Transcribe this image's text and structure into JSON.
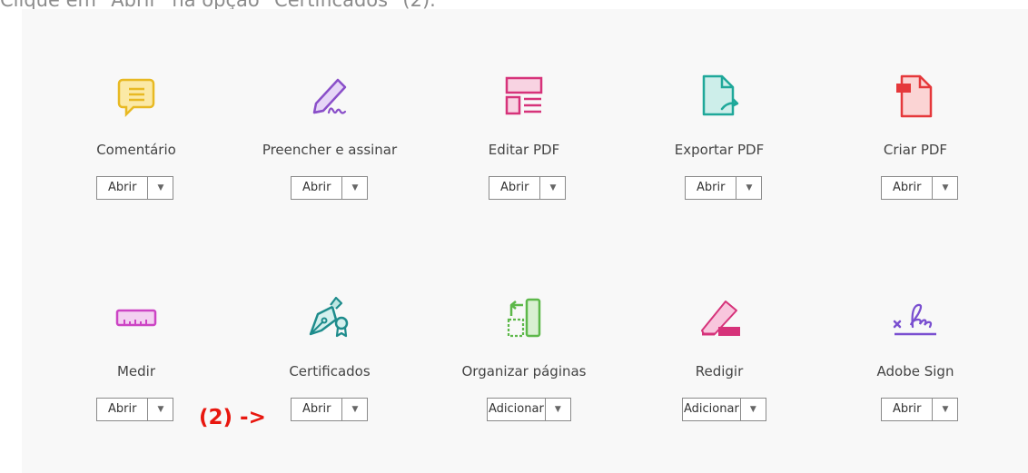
{
  "caption": "Clique em \"Abrir\" na opção \"Certificados\" (2).",
  "annotation": "(2) ->",
  "tools": [
    {
      "label": "Comentário",
      "button": "Abrir",
      "icon": "comment-icon",
      "color": "#e8b923"
    },
    {
      "label": "Preencher e assinar",
      "button": "Abrir",
      "icon": "fill-sign-icon",
      "color": "#8a4fc9"
    },
    {
      "label": "Editar PDF",
      "button": "Abrir",
      "icon": "edit-pdf-icon",
      "color": "#d6337a"
    },
    {
      "label": "Exportar PDF",
      "button": "Abrir",
      "icon": "export-pdf-icon",
      "color": "#1fa89a"
    },
    {
      "label": "Criar PDF",
      "button": "Abrir",
      "icon": "create-pdf-icon",
      "color": "#e5383b"
    },
    {
      "label": "Medir",
      "button": "Abrir",
      "icon": "measure-icon",
      "color": "#cc44c4"
    },
    {
      "label": "Certificados",
      "button": "Abrir",
      "icon": "certificates-icon",
      "color": "#1e8c8c"
    },
    {
      "label": "Organizar páginas",
      "button": "Adicionar",
      "icon": "organize-pages-icon",
      "color": "#5db84a"
    },
    {
      "label": "Redigir",
      "button": "Adicionar",
      "icon": "redact-icon",
      "color": "#d6337a"
    },
    {
      "label": "Adobe Sign",
      "button": "Abrir",
      "icon": "adobe-sign-icon",
      "color": "#7a4fd0"
    }
  ]
}
